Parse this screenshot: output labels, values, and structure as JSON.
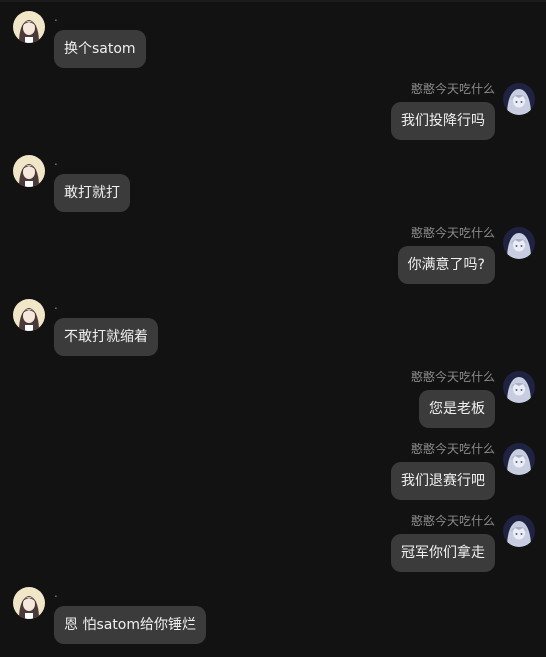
{
  "messages": [
    {
      "side": "left",
      "avatar": "anime-girl-avatar",
      "name": ".",
      "text": "换个satom"
    },
    {
      "side": "right",
      "avatar": "anime-silver-avatar",
      "name": "憨憨今天吃什么",
      "text": "我们投降行吗"
    },
    {
      "side": "left",
      "avatar": "anime-girl-avatar",
      "name": ".",
      "text": "敢打就打"
    },
    {
      "side": "right",
      "avatar": "anime-silver-avatar",
      "name": "憨憨今天吃什么",
      "text": "你满意了吗?"
    },
    {
      "side": "left",
      "avatar": "anime-girl-avatar",
      "name": ".",
      "text": "不敢打就缩着"
    },
    {
      "side": "right",
      "avatar": "anime-silver-avatar",
      "name": "憨憨今天吃什么",
      "text": "您是老板"
    },
    {
      "side": "right",
      "avatar": "anime-silver-avatar",
      "name": "憨憨今天吃什么",
      "text": "我们退赛行吧"
    },
    {
      "side": "right",
      "avatar": "anime-silver-avatar",
      "name": "憨憨今天吃什么",
      "text": "冠军你们拿走"
    },
    {
      "side": "left",
      "avatar": "anime-girl-avatar",
      "name": ".",
      "text": "恩 怕satom给你锤烂"
    }
  ],
  "colors": {
    "background": "#121212",
    "bubble": "#3b3b3b",
    "name_text": "#8a8a8a",
    "message_text": "#f0f0f0"
  }
}
